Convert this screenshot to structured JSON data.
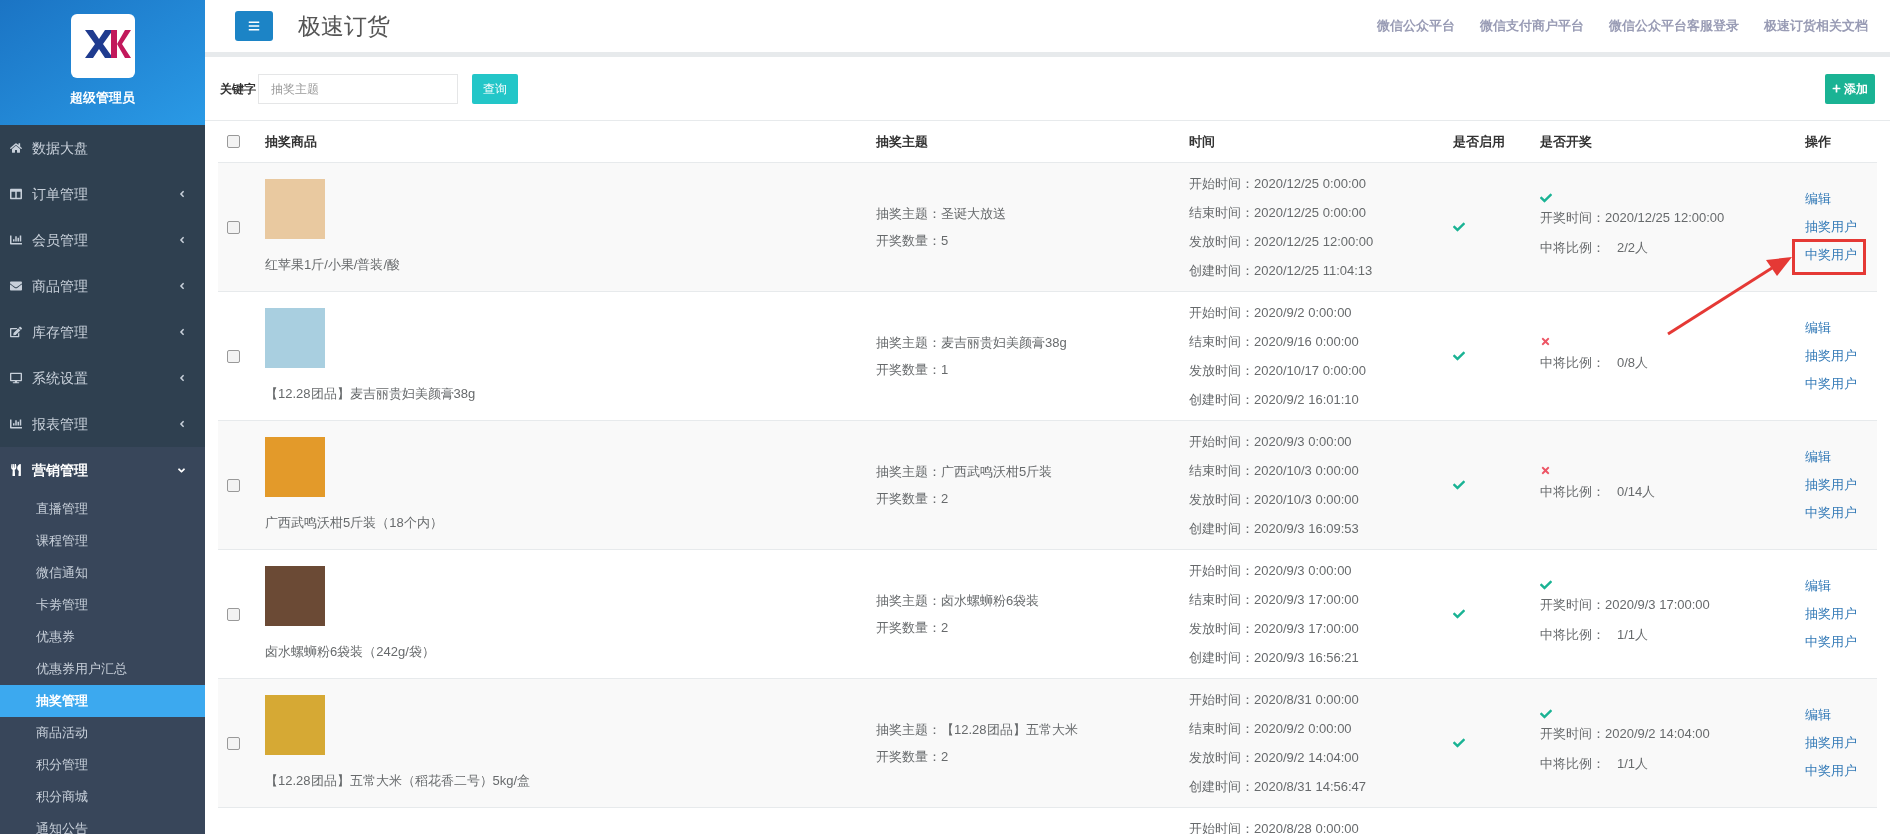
{
  "sidebar": {
    "user": "超级管理员",
    "items": [
      {
        "label": "数据大盘",
        "kind": "link"
      },
      {
        "label": "订单管理",
        "kind": "group",
        "expanded": false
      },
      {
        "label": "会员管理",
        "kind": "group",
        "expanded": false
      },
      {
        "label": "商品管理",
        "kind": "group",
        "expanded": false
      },
      {
        "label": "库存管理",
        "kind": "group",
        "expanded": false
      },
      {
        "label": "系统设置",
        "kind": "group",
        "expanded": false
      },
      {
        "label": "报表管理",
        "kind": "group",
        "expanded": false
      },
      {
        "label": "营销管理",
        "kind": "group",
        "expanded": true,
        "children": [
          {
            "label": "直播管理",
            "selected": false
          },
          {
            "label": "课程管理",
            "selected": false
          },
          {
            "label": "微信通知",
            "selected": false
          },
          {
            "label": "卡劵管理",
            "selected": false
          },
          {
            "label": "优惠券",
            "selected": false
          },
          {
            "label": "优惠券用户汇总",
            "selected": false
          },
          {
            "label": "抽奖管理",
            "selected": true
          },
          {
            "label": "商品活动",
            "selected": false
          },
          {
            "label": "积分管理",
            "selected": false
          },
          {
            "label": "积分商城",
            "selected": false
          },
          {
            "label": "通知公告",
            "selected": false
          }
        ]
      }
    ]
  },
  "header": {
    "title": "极速订货",
    "links": [
      "微信公众平台",
      "微信支付商户平台",
      "微信公众平台客服登录",
      "极速订货相关文档"
    ]
  },
  "search": {
    "label": "关键字",
    "placeholder": "抽奖主题",
    "button": "查询",
    "add_button": "添加"
  },
  "table": {
    "select_all_checked": false,
    "columns": [
      "抽奖商品",
      "抽奖主题",
      "时间",
      "是否启用",
      "是否开奖",
      "操作"
    ],
    "rows": [
      {
        "checked": false,
        "product": "红苹果1斤/小果/普装/酸",
        "theme_label": "抽奖主题：",
        "theme": "圣诞大放送",
        "count_label": "开奖数量：",
        "count": "5",
        "times": [
          [
            "开始时间：",
            "2020/12/25 0:00:00"
          ],
          [
            "结束时间：",
            "2020/12/25 0:00:00"
          ],
          [
            "发放时间：",
            "2020/12/25 12:00:00"
          ],
          [
            "创建时间：",
            "2020/12/25 11:04:13"
          ]
        ],
        "enabled": true,
        "drawn": true,
        "draw_time_label": "开奖时间：",
        "draw_time": "2020/12/25 12:00:00",
        "ratio_label": "中将比例：",
        "ratio": "2/2人",
        "actions": [
          "编辑",
          "抽奖用户",
          "中奖用户"
        ]
      },
      {
        "checked": false,
        "product": "【12.28团品】麦吉丽贵妇美颜膏38g",
        "theme_label": "抽奖主题：",
        "theme": "麦吉丽贵妇美颜膏38g",
        "count_label": "开奖数量：",
        "count": "1",
        "times": [
          [
            "开始时间：",
            "2020/9/2 0:00:00"
          ],
          [
            "结束时间：",
            "2020/9/16 0:00:00"
          ],
          [
            "发放时间：",
            "2020/10/17 0:00:00"
          ],
          [
            "创建时间：",
            "2020/9/2 16:01:10"
          ]
        ],
        "enabled": true,
        "drawn": false,
        "ratio_label": "中将比例：",
        "ratio": "0/8人",
        "actions": [
          "编辑",
          "抽奖用户",
          "中奖用户"
        ]
      },
      {
        "checked": false,
        "product": "广西武鸣沃柑5斤装（18个内）",
        "theme_label": "抽奖主题：",
        "theme": "广西武鸣沃柑5斤装",
        "count_label": "开奖数量：",
        "count": "2",
        "times": [
          [
            "开始时间：",
            "2020/9/3 0:00:00"
          ],
          [
            "结束时间：",
            "2020/10/3 0:00:00"
          ],
          [
            "发放时间：",
            "2020/10/3 0:00:00"
          ],
          [
            "创建时间：",
            "2020/9/3 16:09:53"
          ]
        ],
        "enabled": true,
        "drawn": false,
        "ratio_label": "中将比例：",
        "ratio": "0/14人",
        "actions": [
          "编辑",
          "抽奖用户",
          "中奖用户"
        ]
      },
      {
        "checked": false,
        "product": "卤水螺蛳粉6袋装（242g/袋）",
        "theme_label": "抽奖主题：",
        "theme": "卤水螺蛳粉6袋装",
        "count_label": "开奖数量：",
        "count": "2",
        "times": [
          [
            "开始时间：",
            "2020/9/3 0:00:00"
          ],
          [
            "结束时间：",
            "2020/9/3 17:00:00"
          ],
          [
            "发放时间：",
            "2020/9/3 17:00:00"
          ],
          [
            "创建时间：",
            "2020/9/3 16:56:21"
          ]
        ],
        "enabled": true,
        "drawn": true,
        "draw_time_label": "开奖时间：",
        "draw_time": "2020/9/3 17:00:00",
        "ratio_label": "中将比例：",
        "ratio": "1/1人",
        "actions": [
          "编辑",
          "抽奖用户",
          "中奖用户"
        ]
      },
      {
        "checked": false,
        "product": "【12.28团品】五常大米（稻花香二号）5kg/盒",
        "theme_label": "抽奖主题：",
        "theme": "【12.28团品】五常大米",
        "count_label": "开奖数量：",
        "count": "2",
        "times": [
          [
            "开始时间：",
            "2020/8/31 0:00:00"
          ],
          [
            "结束时间：",
            "2020/9/2 0:00:00"
          ],
          [
            "发放时间：",
            "2020/9/2 14:04:00"
          ],
          [
            "创建时间：",
            "2020/8/31 14:56:47"
          ]
        ],
        "enabled": true,
        "drawn": true,
        "draw_time_label": "开奖时间：",
        "draw_time": "2020/9/2 14:04:00",
        "ratio_label": "中将比例：",
        "ratio": "1/1人",
        "actions": [
          "编辑",
          "抽奖用户",
          "中奖用户"
        ]
      },
      {
        "times": [
          [
            "开始时间：",
            "2020/8/28 0:00:00"
          ]
        ]
      }
    ]
  }
}
